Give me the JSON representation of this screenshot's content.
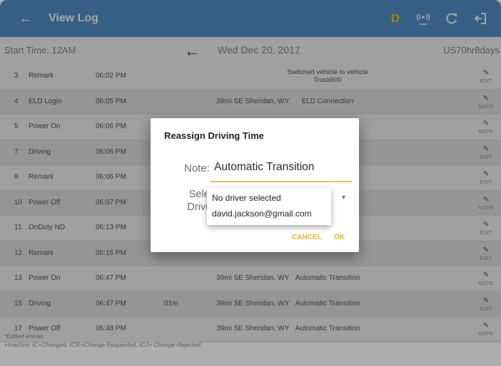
{
  "appbar": {
    "back_icon": "arrow-left-icon",
    "title": "View Log",
    "driver_badge": "D",
    "icons": [
      "wireless-signal-icon",
      "refresh-icon",
      "logout-icon"
    ]
  },
  "nav": {
    "start_time": "Start Time: 12AM",
    "date": "Wed Dec 20, 2017",
    "cycle": "US70hr8days"
  },
  "log": [
    {
      "num": "3",
      "event": "Remark",
      "time": "06:02 PM",
      "duration": "",
      "location": "",
      "note": "Switched vehicle  to vehicle Truck600",
      "action": "EDIT"
    },
    {
      "num": "4",
      "event": "ELD Login",
      "time": "06:05 PM",
      "duration": "",
      "location": "39mi SE Sheridan, WY",
      "note": "ELD Connection",
      "action": "NOTE"
    },
    {
      "num": "5",
      "event": "Power On",
      "time": "06:06 PM",
      "duration": "",
      "location": "",
      "note": "",
      "action": "NOTE"
    },
    {
      "num": "7",
      "event": "Driving",
      "time": "06:06 PM",
      "duration": "",
      "location": "",
      "note": "",
      "action": "EDIT"
    },
    {
      "num": "8",
      "event": "Remark",
      "time": "06:06 PM",
      "duration": "",
      "location": "",
      "note": "",
      "action": "EDIT"
    },
    {
      "num": "10",
      "event": "Power Off",
      "time": "06:07 PM",
      "duration": "",
      "location": "",
      "note": "",
      "action": "NOTE"
    },
    {
      "num": "11",
      "event": "OnDuty ND",
      "time": "06:13 PM",
      "duration": "",
      "location": "",
      "note": "",
      "action": "EDIT"
    },
    {
      "num": "12",
      "event": "Remark",
      "time": "06:16 PM",
      "duration": "",
      "location": "",
      "note": "",
      "action": "EDIT"
    },
    {
      "num": "13",
      "event": "Power On",
      "time": "06:47 PM",
      "duration": "",
      "location": "39mi SE Sheridan, WY",
      "note": "Automatic Transition",
      "action": "NOTE"
    },
    {
      "num": "15",
      "event": "Driving",
      "time": "06:47 PM",
      "duration": "01m",
      "location": "39mi SE Sheridan, WY",
      "note": "Automatic Transition",
      "action": "EDIT"
    },
    {
      "num": "17",
      "event": "Power Off",
      "time": "06:48 PM",
      "duration": "",
      "location": "39mi SE Sheridan, WY",
      "note": "Automatic Transition",
      "action": "NOTE"
    }
  ],
  "footer": {
    "line1": "*Edited entries",
    "line2": "+Inactive: IC=Changed, ICR=Change Requested, ICJ= Change Rejected"
  },
  "dialog": {
    "title": "Reassign Driving Time",
    "note_label": "Note:",
    "note_value": "Automatic Transition",
    "select_label_1": "Select",
    "select_label_2": "Driver:",
    "options": [
      "No driver selected",
      "david.jackson@gmail.com"
    ],
    "cancel": "CANCEL",
    "ok": "OK"
  },
  "colors": {
    "appbar": "#4f8cc4",
    "driver_badge": "#f4c21a",
    "accent": "#e8b52a"
  }
}
